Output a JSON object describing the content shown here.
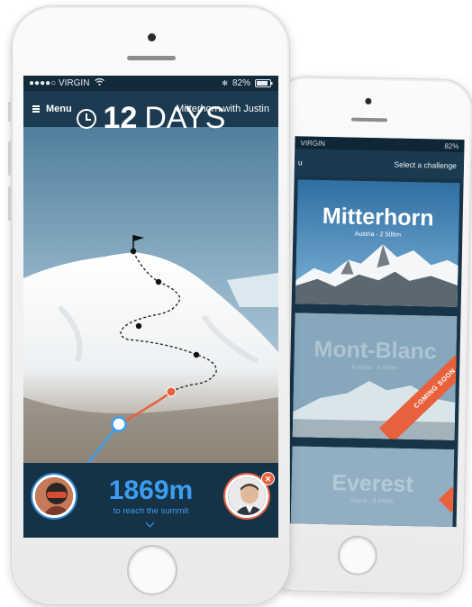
{
  "front": {
    "status": {
      "carrier": "●●●●○ VIRGIN",
      "wifi": "wifi-icon",
      "bluetooth": "✻",
      "battery": "82%"
    },
    "nav": {
      "menu_label": "Menu",
      "title": "Mitterhorn with Justin"
    },
    "countdown": {
      "number": "12",
      "unit": "DAYS"
    },
    "progress": {
      "value": "1869m",
      "caption": "to reach the summit"
    },
    "badge": "✕",
    "colors": {
      "accent_orange": "#e8603c",
      "accent_blue": "#3b9ef0",
      "navy": "#173448"
    }
  },
  "back": {
    "status": {
      "carrier": "VIRGIN",
      "battery": "82%"
    },
    "nav": {
      "menu_label": "u",
      "title": "Select a challenge"
    },
    "challenges": [
      {
        "name": "Mitterhorn",
        "subtitle": "Austria - 2 506m",
        "available": true
      },
      {
        "name": "Mont-Blanc",
        "subtitle": "France - 4 809m",
        "available": false,
        "ribbon": "COMING SOON"
      },
      {
        "name": "Everest",
        "subtitle": "Nepal - 8 848m",
        "available": false
      }
    ]
  }
}
